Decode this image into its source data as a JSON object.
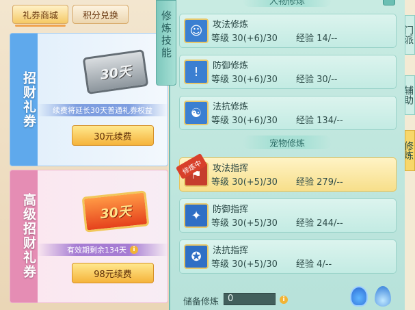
{
  "shop": {
    "tabs": {
      "shop": "礼券商城",
      "points": "积分兑换"
    },
    "card1": {
      "title": "招财礼券",
      "ticket_text": "30天",
      "info": "续费将延长30天普通礼券权益",
      "button": "30元续费"
    },
    "card2": {
      "title": "高级招财礼券",
      "ticket_text": "30天",
      "info": "有效期剩余134天",
      "button": "98元续费"
    }
  },
  "cultivation": {
    "side_tab": "修炼技能",
    "person_header": "人物修炼",
    "pet_header": "宠物修炼",
    "level_label": "等级",
    "exp_label": "经验",
    "skills": [
      {
        "name": "攻法修炼",
        "level": "30(+6)/30",
        "exp": "14/--",
        "icon": "attack-figure-icon",
        "color": "#3b7fd1"
      },
      {
        "name": "防御修炼",
        "level": "30(+6)/30",
        "exp": "30/--",
        "icon": "defense-shield-icon",
        "color": "#3b7fd1"
      },
      {
        "name": "法抗修炼",
        "level": "30(+6)/30",
        "exp": "134/--",
        "icon": "taiji-icon",
        "color": "#3b7fd1"
      },
      {
        "name": "攻法指挥",
        "level": "30(+5)/30",
        "exp": "279/--",
        "icon": "command-banner-icon",
        "color": "#c63d2d",
        "badge": "修炼中"
      },
      {
        "name": "防御指挥",
        "level": "30(+5)/30",
        "exp": "244/--",
        "icon": "paw-shield-icon",
        "color": "#2f6fc5"
      },
      {
        "name": "法抗指挥",
        "level": "30(+5)/30",
        "exp": "4/--",
        "icon": "paw-badge-icon",
        "color": "#2f6fc5"
      }
    ],
    "reserve_label": "储备修炼",
    "reserve_value": "0"
  },
  "right_tabs": {
    "sect": "门派",
    "aux": "辅助",
    "cult": "修炼"
  }
}
